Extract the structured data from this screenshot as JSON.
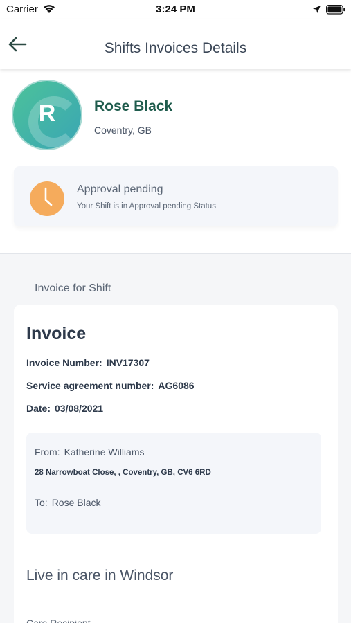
{
  "status_bar": {
    "carrier": "Carrier",
    "time": "3:24 PM"
  },
  "header": {
    "title": "Shifts Invoices Details",
    "back_icon": "back-arrow-icon"
  },
  "profile": {
    "initial": "R",
    "name": "Rose Black",
    "location": "Coventry, GB",
    "avatar_colors": [
      "#4cc29a",
      "#3aa6b4"
    ]
  },
  "approval": {
    "title": "Approval pending",
    "subtitle": "Your Shift is in Approval pending Status",
    "icon": "clock-icon",
    "icon_color": "#f5ab5c"
  },
  "invoice_section": {
    "label": "Invoice for Shift"
  },
  "invoice": {
    "heading": "Invoice",
    "number_label": "Invoice Number:",
    "number_value": "INV17307",
    "agreement_label": "Service agreement number:",
    "agreement_value": "AG6086",
    "date_label": "Date:",
    "date_value": "03/08/2021",
    "from_label": "From:",
    "from_value": "Katherine Williams",
    "address": "28 Narrowboat Close, , Coventry, GB, CV6 6RD",
    "to_label": "To:",
    "to_value": "Rose Black",
    "care_title": "Live in care in Windsor",
    "care_recipient_label": "Care Recipient"
  },
  "colors": {
    "accent_green": "#1f5c4d",
    "pending_orange": "#f5ab5c",
    "text_dark": "#2e3a4b",
    "page_bg": "#f5f6f8"
  }
}
